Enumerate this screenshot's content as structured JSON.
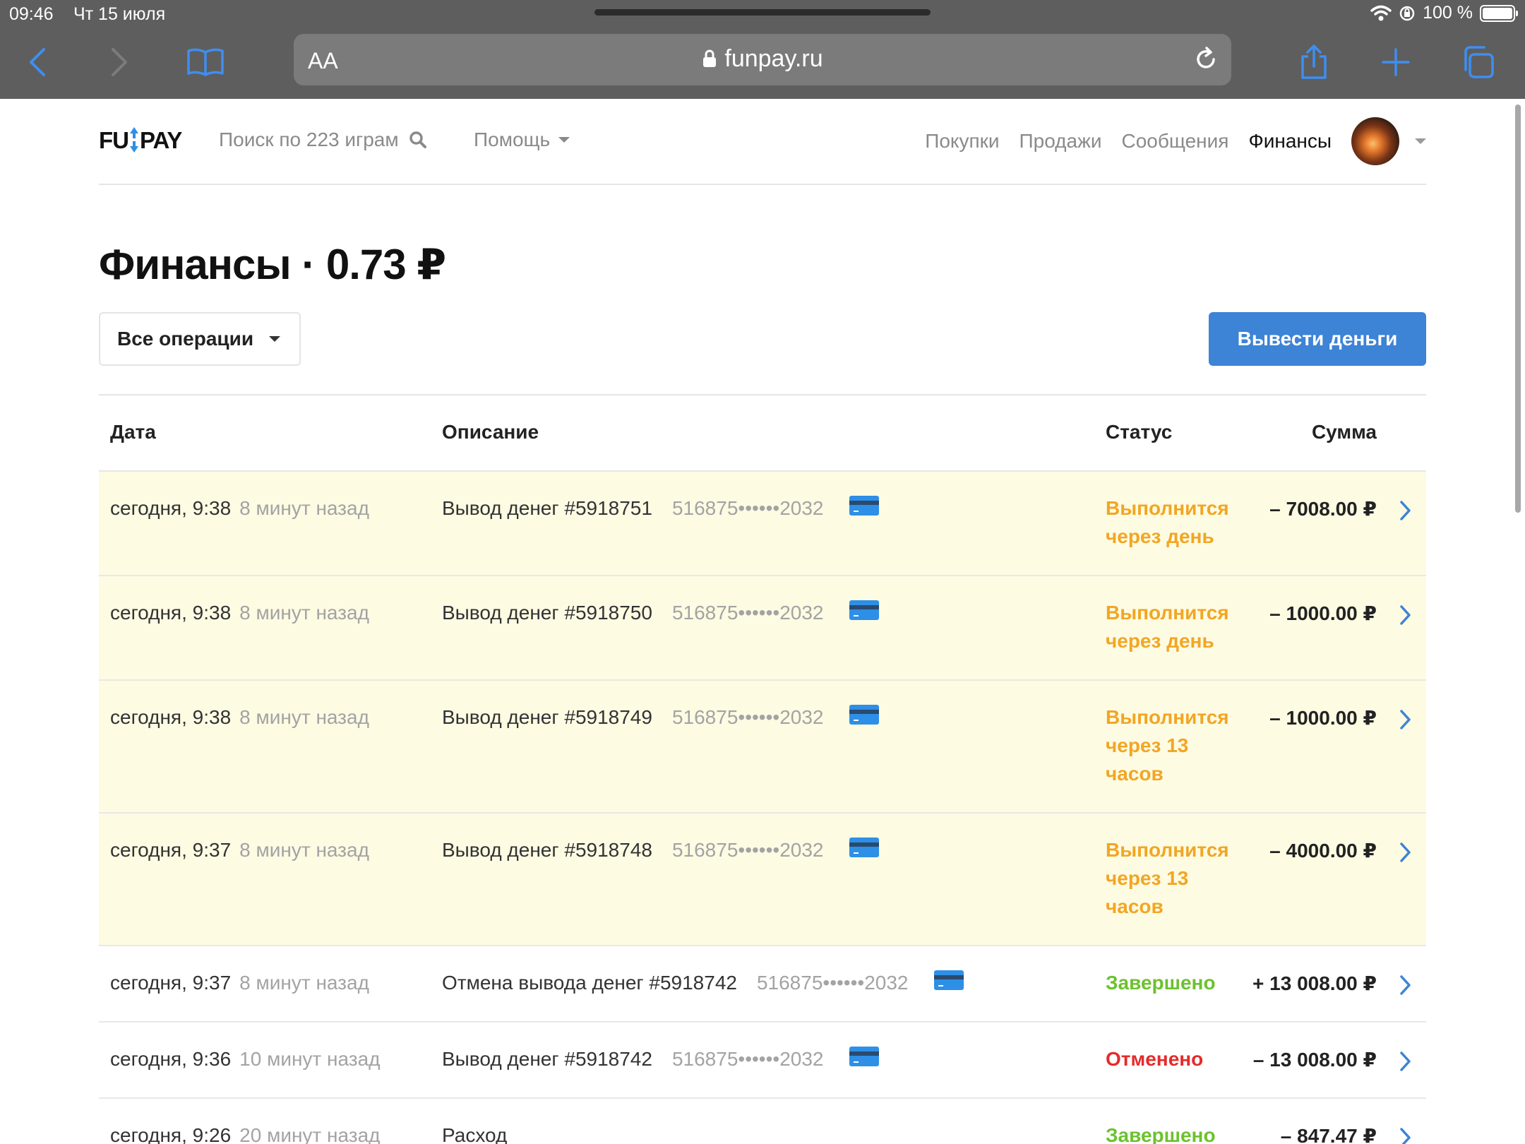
{
  "status_bar": {
    "time": "09:46",
    "date": "Чт 15 июля",
    "battery": "100 %"
  },
  "browser": {
    "aa_label": "AA",
    "url": "funpay.ru"
  },
  "site": {
    "logo": {
      "left": "FU",
      "right": "PAY"
    },
    "search_label": "Поиск по 223 играм",
    "help_label": "Помощь",
    "nav": [
      "Покупки",
      "Продажи",
      "Сообщения",
      "Финансы"
    ],
    "active_nav": "Финансы"
  },
  "page": {
    "title": "Финансы · 0.73 ₽",
    "filter_label": "Все операции",
    "withdraw_label": "Вывести деньги"
  },
  "table": {
    "headers": {
      "date": "Дата",
      "description": "Описание",
      "status": "Статус",
      "amount": "Сумма"
    },
    "rows": [
      {
        "date": "сегодня, 9:38",
        "ago": "8 минут назад",
        "desc": "Вывод денег #5918751",
        "card": "516875••••••2032",
        "status": "Выполнится через день",
        "status_type": "pending",
        "amount": "– 7008.00 ₽"
      },
      {
        "date": "сегодня, 9:38",
        "ago": "8 минут назад",
        "desc": "Вывод денег #5918750",
        "card": "516875••••••2032",
        "status": "Выполнится через день",
        "status_type": "pending",
        "amount": "– 1000.00 ₽"
      },
      {
        "date": "сегодня, 9:38",
        "ago": "8 минут назад",
        "desc": "Вывод денег #5918749",
        "card": "516875••••••2032",
        "status": "Выполнится через 13 часов",
        "status_type": "pending",
        "amount": "– 1000.00 ₽"
      },
      {
        "date": "сегодня, 9:37",
        "ago": "8 минут назад",
        "desc": "Вывод денег #5918748",
        "card": "516875••••••2032",
        "status": "Выполнится через 13 часов",
        "status_type": "pending",
        "amount": "– 4000.00 ₽"
      },
      {
        "date": "сегодня, 9:37",
        "ago": "8 минут назад",
        "desc": "Отмена вывода денег #5918742",
        "card": "516875••••••2032",
        "status": "Завершено",
        "status_type": "done",
        "amount": "+ 13 008.00 ₽"
      },
      {
        "date": "сегодня, 9:36",
        "ago": "10 минут назад",
        "desc": "Вывод денег #5918742",
        "card": "516875••••••2032",
        "status": "Отменено",
        "status_type": "cancel",
        "amount": "– 13 008.00 ₽"
      },
      {
        "date": "сегодня, 9:26",
        "ago": "20 минут назад",
        "desc": "Расход",
        "card": "",
        "status": "Завершено",
        "status_type": "done",
        "amount": "– 847.47 ₽"
      }
    ]
  },
  "colors": {
    "accent": "#3d83d6",
    "pending": "#f2a623",
    "done": "#6cc22e",
    "cancel": "#e52b2b",
    "pending_row_bg": "#fefbe3",
    "safari_chrome": "#5e5e5e",
    "safari_tint": "#3f8ef0"
  }
}
